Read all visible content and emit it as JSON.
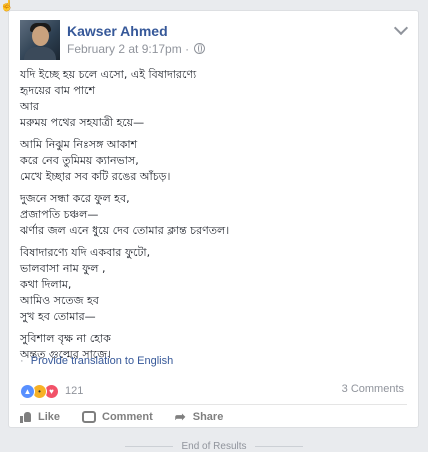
{
  "post": {
    "author": "Kawser Ahmed",
    "timestamp": "February 2 at 9:17pm",
    "separator": "·",
    "privacy_icon": "globe-icon",
    "menu_icon": "chevron-down-icon",
    "stanzas": [
      [
        "যদি ইচ্ছে হয় চলে এসো, এই বিষাদারণ্যে",
        "হৃদয়ের বাম পাশে",
        "আর",
        "মরুময় পথের সহযাত্রী হয়ে—"
      ],
      [
        "আমি নিঝুম নিঃসঙ্গ আকাশ",
        "করে নেব তুমিময় ক্যানভাস,",
        "মেখে ইচ্ছার সব কটি রঙের আঁচড়।"
      ],
      [
        "দুজনে সন্ধা করে ফুল হব,",
        "প্রজাপতি চঞ্চল—",
        "ঝর্ণার জল এনে ধুয়ে দেব তোমার ক্লান্ত চরণতল।"
      ],
      [
        "বিষাদারণ্যে যদি একবার ফুটো,",
        "ভালবাসা নাম ফুল ,",
        "কথা দিলাম,",
        "আমিও সতেজ হব",
        "সুখ হব তোমার—"
      ],
      [
        "সুবিশাল বৃক্ষ না হোক",
        "অন্তত গুল্মের সাজে।"
      ]
    ],
    "translate_link": "Provide translation to English",
    "translate_bullet": "·",
    "reactions": {
      "icons": [
        "like",
        "wow",
        "love"
      ],
      "count": "121"
    },
    "comments": "3 Comments",
    "actions": {
      "like": "Like",
      "comment": "Comment",
      "share": "Share"
    }
  },
  "footer": {
    "end_of_results": "End of Results"
  },
  "colors": {
    "link": "#365899",
    "muted": "#90949c",
    "like_blue": "#5890ff",
    "love_red": "#f25268",
    "wow_yellow": "#f7b125"
  }
}
